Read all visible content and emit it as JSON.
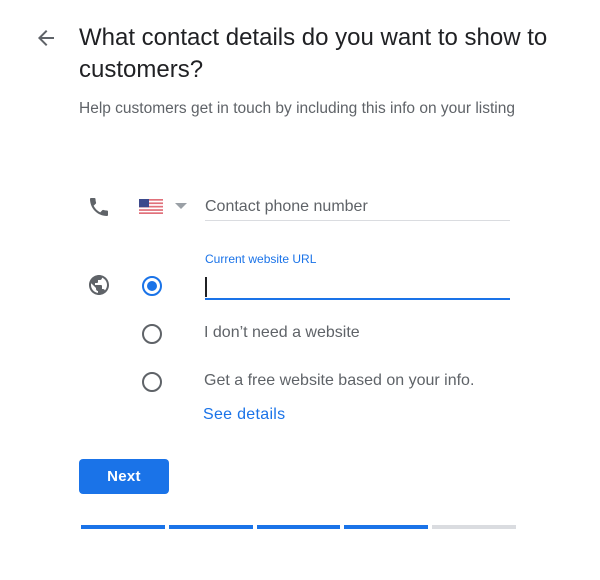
{
  "header": {
    "back_icon": "arrow-back-icon",
    "title": "What contact details do you want to show to customers?",
    "subtitle": "Help customers get in touch by including this info on your listing"
  },
  "phone": {
    "icon": "phone-icon",
    "country_flag": "US",
    "country_dropdown_icon": "caret-down-icon",
    "value": "",
    "placeholder": "Contact phone number"
  },
  "website": {
    "icon": "globe-icon",
    "options": [
      {
        "type": "url",
        "label": "Current website URL",
        "value": "",
        "selected": true
      },
      {
        "type": "none",
        "label": "I don’t need a website",
        "selected": false
      },
      {
        "type": "free",
        "label": "Get a free website based on your info.",
        "selected": false
      }
    ],
    "see_details_link": "See details"
  },
  "actions": {
    "next_label": "Next"
  },
  "progress": {
    "completed_steps": 4,
    "total_steps": 5
  },
  "colors": {
    "accent": "#1a73e8",
    "text_primary": "#202124",
    "text_secondary": "#5f6368",
    "divider": "#dadce0"
  }
}
